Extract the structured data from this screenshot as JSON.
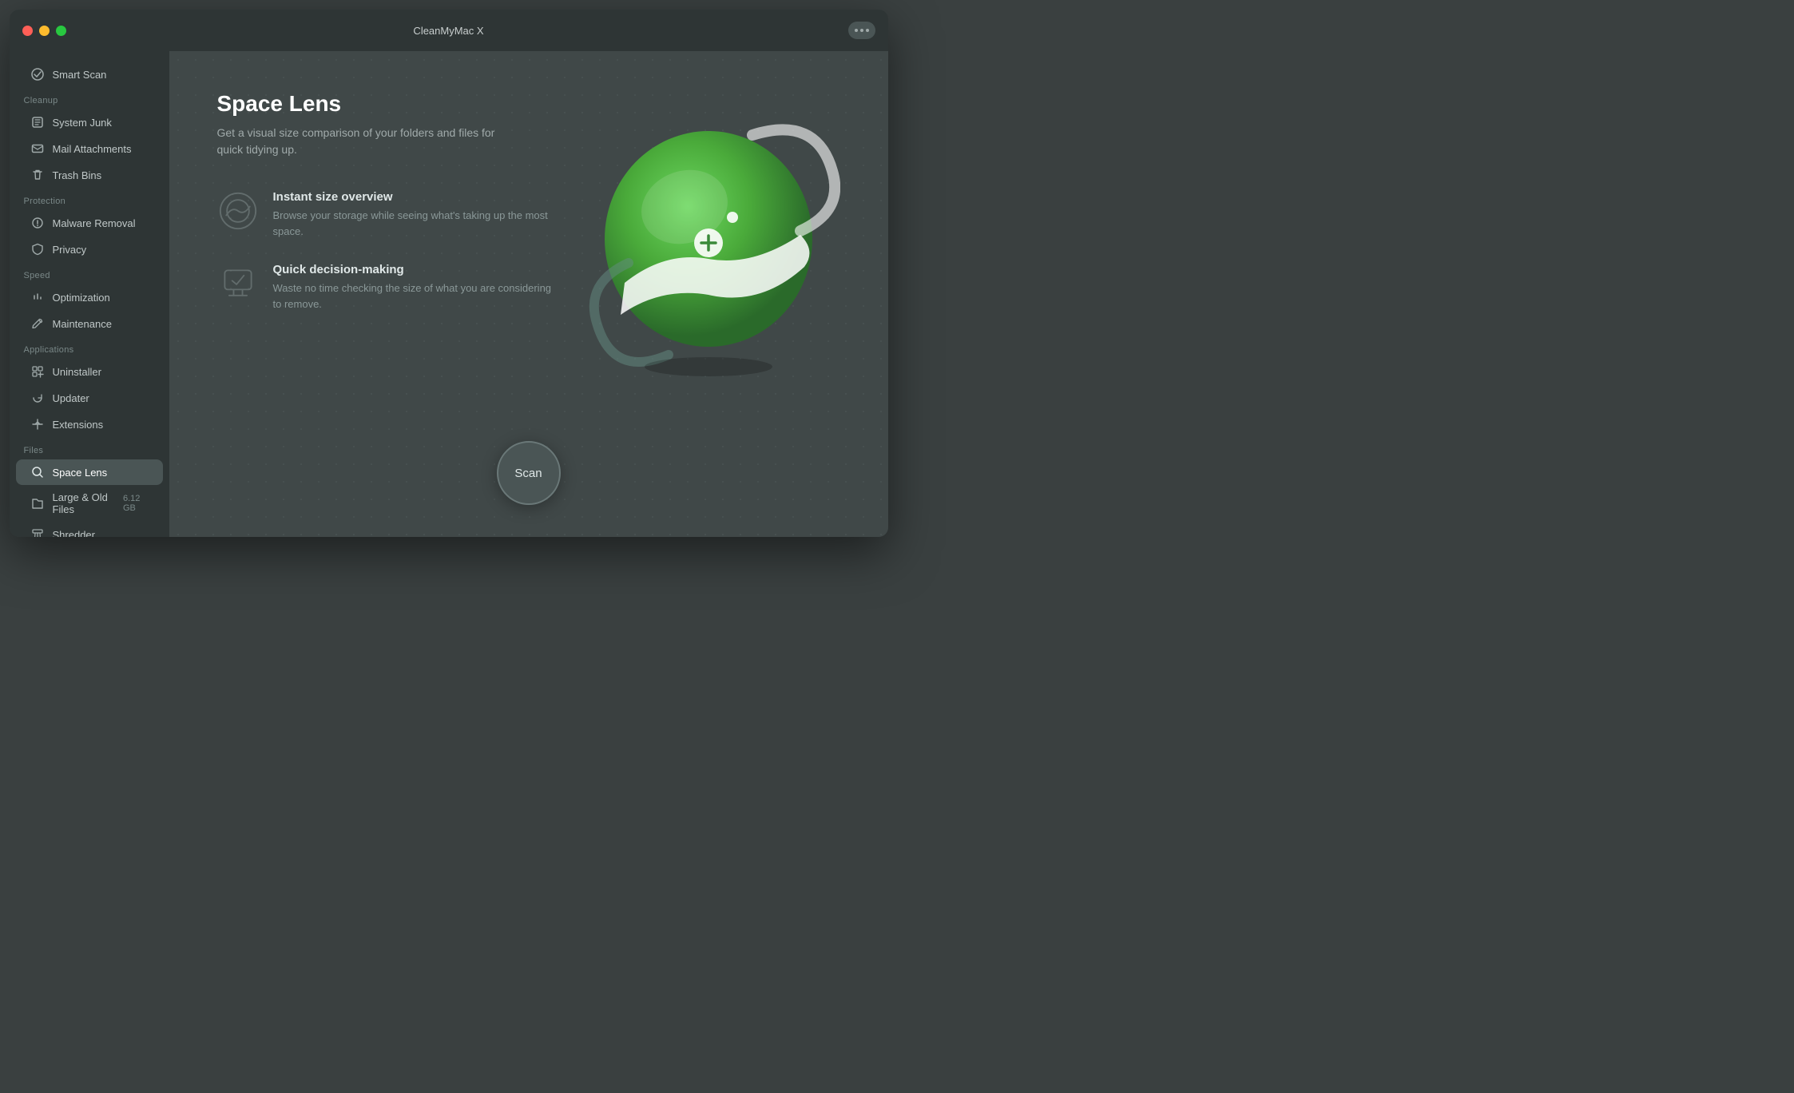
{
  "window": {
    "title": "CleanMyMac X"
  },
  "sidebar": {
    "smart_scan_label": "Smart Scan",
    "sections": [
      {
        "label": "Cleanup",
        "items": [
          {
            "id": "system-junk",
            "label": "System Junk",
            "icon": "🛡",
            "badge": ""
          },
          {
            "id": "mail-attachments",
            "label": "Mail Attachments",
            "icon": "✉",
            "badge": ""
          },
          {
            "id": "trash-bins",
            "label": "Trash Bins",
            "icon": "🗑",
            "badge": ""
          }
        ]
      },
      {
        "label": "Protection",
        "items": [
          {
            "id": "malware-removal",
            "label": "Malware Removal",
            "icon": "☣",
            "badge": ""
          },
          {
            "id": "privacy",
            "label": "Privacy",
            "icon": "🤚",
            "badge": ""
          }
        ]
      },
      {
        "label": "Speed",
        "items": [
          {
            "id": "optimization",
            "label": "Optimization",
            "icon": "⇅",
            "badge": ""
          },
          {
            "id": "maintenance",
            "label": "Maintenance",
            "icon": "🔧",
            "badge": ""
          }
        ]
      },
      {
        "label": "Applications",
        "items": [
          {
            "id": "uninstaller",
            "label": "Uninstaller",
            "icon": "✳",
            "badge": ""
          },
          {
            "id": "updater",
            "label": "Updater",
            "icon": "🔄",
            "badge": ""
          },
          {
            "id": "extensions",
            "label": "Extensions",
            "icon": "↪",
            "badge": ""
          }
        ]
      },
      {
        "label": "Files",
        "items": [
          {
            "id": "space-lens",
            "label": "Space Lens",
            "icon": "◎",
            "badge": "",
            "active": true
          },
          {
            "id": "large-old-files",
            "label": "Large & Old Files",
            "icon": "📁",
            "badge": "6.12 GB"
          },
          {
            "id": "shredder",
            "label": "Shredder",
            "icon": "⚙",
            "badge": ""
          }
        ]
      }
    ]
  },
  "content": {
    "title": "Space Lens",
    "subtitle": "Get a visual size comparison of your folders and files for quick tidying up.",
    "features": [
      {
        "id": "instant-size",
        "title": "Instant size overview",
        "description": "Browse your storage while seeing what's taking up the most space."
      },
      {
        "id": "quick-decision",
        "title": "Quick decision-making",
        "description": "Waste no time checking the size of what you are considering to remove."
      }
    ],
    "scan_button_label": "Scan"
  }
}
